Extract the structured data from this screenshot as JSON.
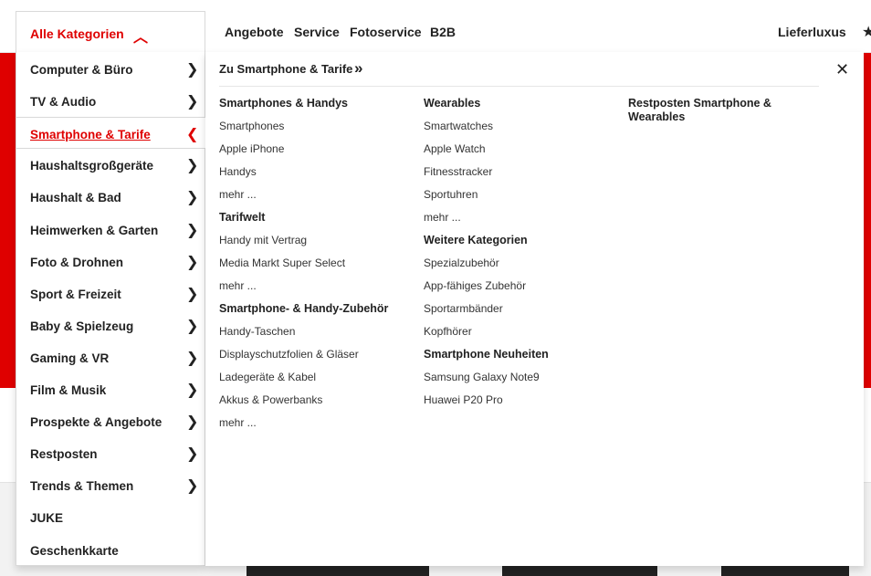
{
  "header": {
    "all_categories": "Alle Kategorien",
    "nav": [
      "Angebote",
      "Service",
      "Fotoservice",
      "B2B"
    ],
    "lieferluxus": "Lieferluxus"
  },
  "sidebar": {
    "items": [
      {
        "label": "Computer & Büro",
        "arrow": true
      },
      {
        "label": "TV & Audio",
        "arrow": true
      },
      {
        "label": "Smartphone & Tarife",
        "arrow": true,
        "active": true
      },
      {
        "label": "Haushaltsgroßgeräte",
        "arrow": true
      },
      {
        "label": "Haushalt & Bad",
        "arrow": true
      },
      {
        "label": "Heimwerken & Garten",
        "arrow": true
      },
      {
        "label": "Foto & Drohnen",
        "arrow": true
      },
      {
        "label": "Sport & Freizeit",
        "arrow": true
      },
      {
        "label": "Baby & Spielzeug",
        "arrow": true
      },
      {
        "label": "Gaming & VR",
        "arrow": true
      },
      {
        "label": "Film & Musik",
        "arrow": true
      },
      {
        "label": "Prospekte & Angebote",
        "arrow": true
      },
      {
        "label": "Restposten",
        "arrow": true
      },
      {
        "label": "Trends & Themen",
        "arrow": true
      },
      {
        "label": "JUKE",
        "arrow": false
      },
      {
        "label": "Geschenkkarte",
        "arrow": false
      }
    ]
  },
  "panel": {
    "heading": "Zu Smartphone & Tarife",
    "columns": [
      {
        "groups": [
          {
            "title": "Smartphones & Handys",
            "links": [
              "Smartphones",
              "Apple iPhone",
              "Handys"
            ],
            "more": "mehr ..."
          },
          {
            "title": "Tarifwelt",
            "links": [
              "Handy mit Vertrag",
              "Media Markt Super Select"
            ],
            "more": "mehr ..."
          },
          {
            "title": "Smartphone- & Handy-Zubehör",
            "links": [
              "Handy-Taschen",
              "Displayschutzfolien & Gläser",
              "Ladegeräte & Kabel",
              "Akkus & Powerbanks"
            ],
            "more": "mehr ..."
          }
        ]
      },
      {
        "groups": [
          {
            "title": "Wearables",
            "links": [
              "Smartwatches",
              "Apple Watch",
              "Fitnesstracker",
              "Sportuhren"
            ],
            "more": "mehr ..."
          },
          {
            "title": "Weitere Kategorien",
            "links": [
              "Spezialzubehör",
              "App-fähiges Zubehör",
              "Sportarmbänder",
              "Kopfhörer"
            ],
            "more": ""
          },
          {
            "title": "Smartphone Neuheiten",
            "links": [
              "Samsung Galaxy Note9",
              "Huawei P20 Pro"
            ],
            "more": ""
          }
        ]
      },
      {
        "groups": [
          {
            "title": "Restposten Smartphone & Wearables",
            "links": [],
            "more": ""
          }
        ]
      }
    ]
  },
  "colors": {
    "accent": "#df0000"
  },
  "icons": {
    "close": "close-icon",
    "chevron_up": "chevron-up-icon",
    "chevron_right": "chevron-right-icon",
    "chevron_left": "chevron-left-icon",
    "double_chevron": "double-chevron-icon",
    "star": "star-icon"
  }
}
